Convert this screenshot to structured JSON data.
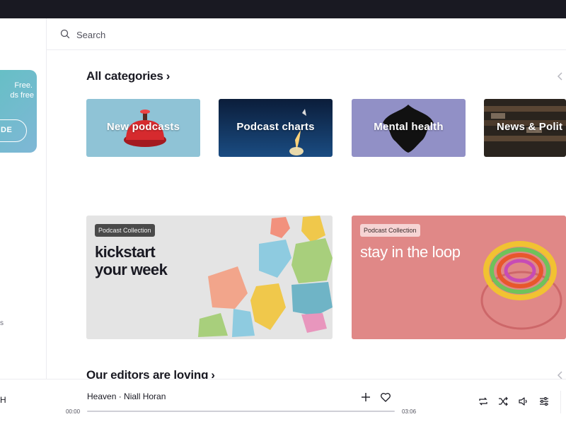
{
  "search": {
    "placeholder": "Search"
  },
  "sidebar": {
    "promo": {
      "line1": "Free.",
      "line2": "ds free",
      "button_label": "DE"
    },
    "cut_text": "s"
  },
  "sections": {
    "categories": {
      "title": "All categories",
      "chevron": "›"
    },
    "editors": {
      "title": "Our editors are loving",
      "chevron": "›"
    }
  },
  "categories": [
    {
      "label": "New podcasts",
      "color": "#8fc3d6"
    },
    {
      "label": "Podcast charts",
      "color": "#0f2d4f"
    },
    {
      "label": "Mental health",
      "color": "#9190c6"
    },
    {
      "label": "News & Polit",
      "color": "#2a241e"
    }
  ],
  "collections": [
    {
      "tag": "Podcast Collection",
      "title_line1": "kickstart",
      "title_line2": "your week",
      "color": "#e4e4e4"
    },
    {
      "tag": "Podcast Collection",
      "title_line1": "stay in the loop",
      "title_line2": "",
      "color": "#e08887"
    }
  ],
  "player": {
    "track": "Heaven · Niall Horan",
    "elapsed": "00:00",
    "duration": "03:06",
    "progress": 0,
    "left_cut_glyph": "H"
  },
  "icons": [
    "search-icon",
    "chevron-left-icon",
    "plus-icon",
    "heart-icon",
    "repeat-icon",
    "shuffle-icon",
    "volume-icon",
    "equalizer-icon"
  ]
}
